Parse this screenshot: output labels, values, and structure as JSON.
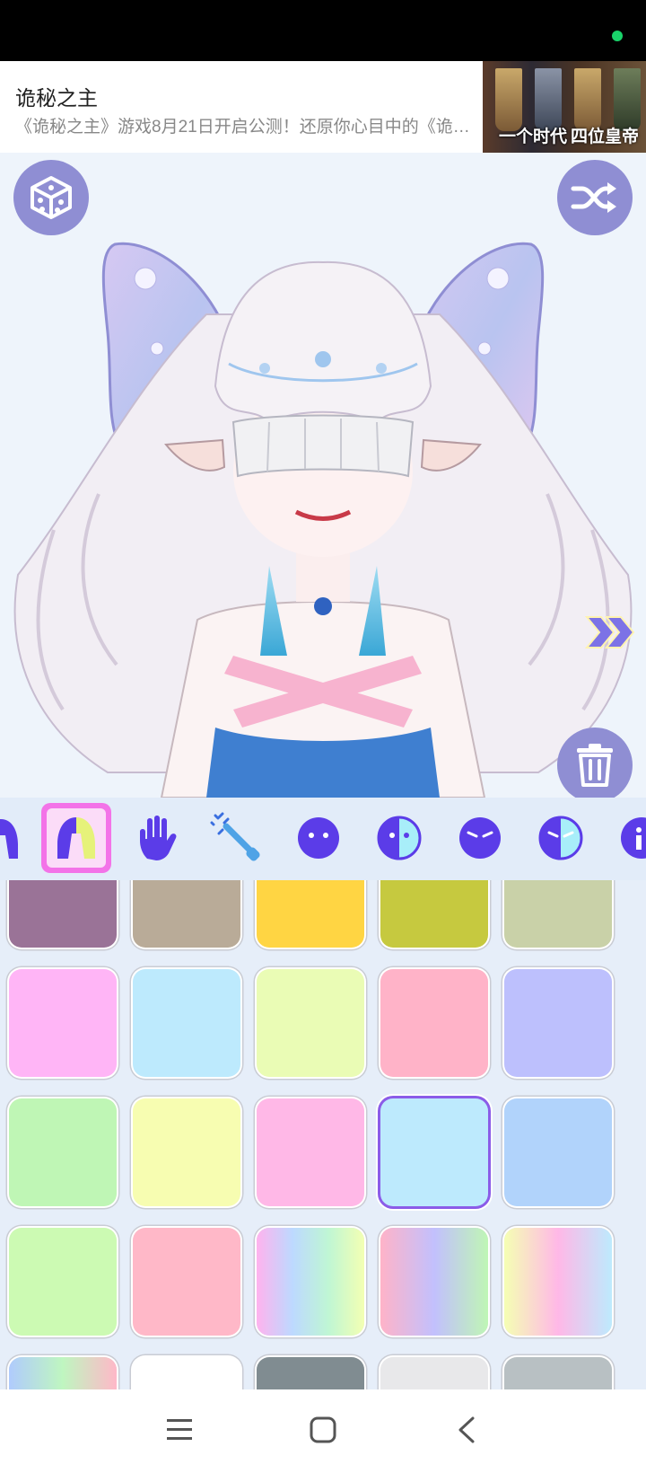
{
  "ad": {
    "title": "诡秘之主",
    "description": "《诡秘之主》游戏8月21日开启公测！还原你心目中的《诡秘之主》",
    "image_caption_left": "一个时代",
    "image_caption_right": "四位皇帝"
  },
  "canvas": {
    "top_left_button": "dice-icon",
    "top_right_button": "shuffle-icon",
    "next_button": "double-chevron-right-icon",
    "bottom_right_button": "trash-icon"
  },
  "toolbar": {
    "selected_index": 1,
    "items": [
      {
        "icon": "hair-icon"
      },
      {
        "icon": "hair-color-icon"
      },
      {
        "icon": "hand-icon"
      },
      {
        "icon": "wand-icon"
      },
      {
        "icon": "face-icon"
      },
      {
        "icon": "face-color-icon"
      },
      {
        "icon": "face-expression-icon"
      },
      {
        "icon": "face-expression-color-icon"
      },
      {
        "icon": "info-face-icon"
      }
    ]
  },
  "palette": {
    "selected_index": 13,
    "colors": [
      "#9a7397",
      "#b9ab98",
      "#ffd543",
      "#c6c93f",
      "#c9d1a8",
      "#ffb5f6",
      "#bdeafd",
      "#eafcb5",
      "#ffb3c8",
      "#bdc0fd",
      "#bff6b5",
      "#f7fdb1",
      "#ffb8e7",
      "#bdeafd",
      "#b1d3fb",
      "#ccfab3",
      "#ffb8c8",
      "linear-gradient(90deg,#ffb3ee,#bdd9ff,#bff6d4,#f3ffb3)",
      "linear-gradient(90deg,#ffb3c8,#c2c0fd,#bff6b5)",
      "linear-gradient(90deg,#f5ffb3,#ffb8e7,#bdeafd)",
      "linear-gradient(90deg,#b0cbfd,#bff6c0,#ffb8c8)",
      "#ffffff",
      "#808c91",
      "#e8e8ea",
      "#b8c0c3"
    ]
  },
  "navbar": {
    "menu_icon": "menu-icon",
    "home_icon": "home-square-icon",
    "back_icon": "back-chevron-icon"
  },
  "colors": {
    "accent": "#8f8ed3",
    "icon_primary": "#5b3ce8",
    "selection": "#8b5ce8",
    "active_tool": "#f373e8"
  }
}
